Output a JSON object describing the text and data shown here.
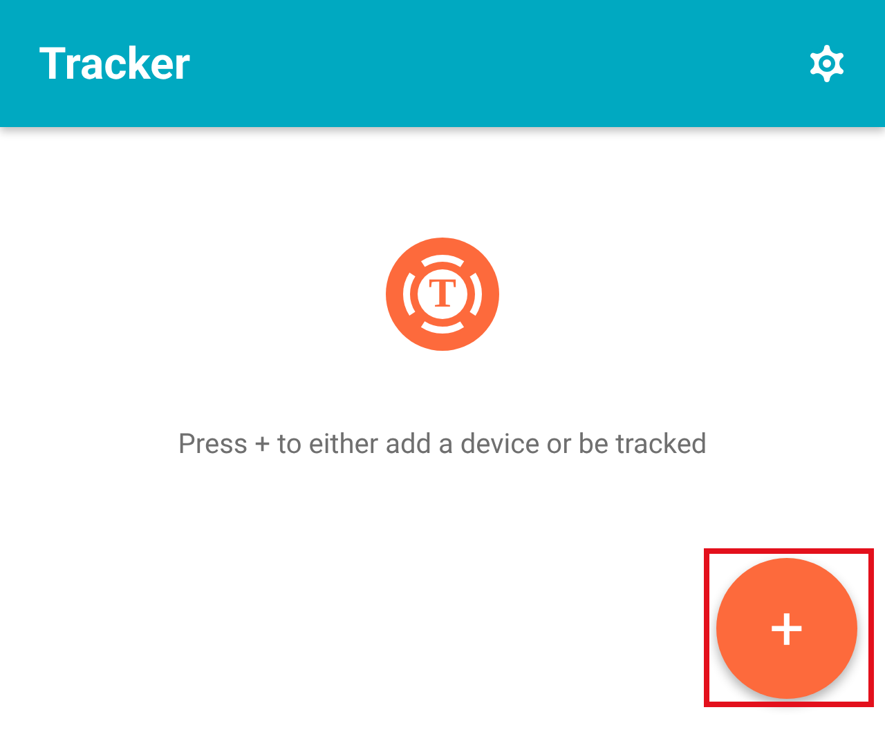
{
  "app_bar": {
    "title": "Tracker"
  },
  "logo": {
    "letter": "T"
  },
  "empty_message": "Press + to either add a device or be tracked",
  "fab": {
    "label": "+",
    "highlighted": true
  }
}
